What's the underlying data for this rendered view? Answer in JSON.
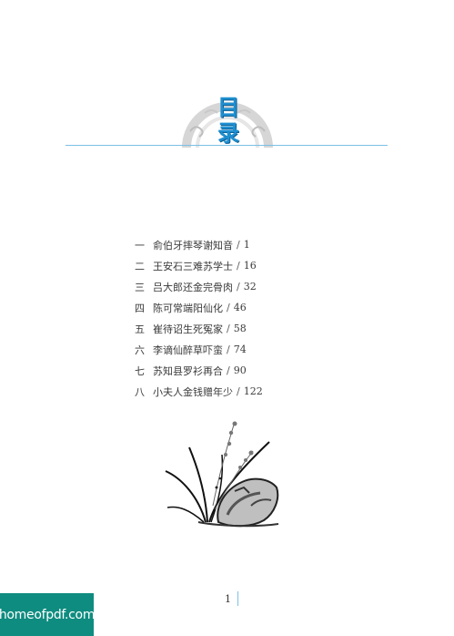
{
  "title": {
    "chars": [
      "目",
      "录"
    ]
  },
  "toc": {
    "items": [
      {
        "num": "一",
        "title": "俞伯牙摔琴谢知音",
        "page": "1"
      },
      {
        "num": "二",
        "title": "王安石三难苏学士",
        "page": "16"
      },
      {
        "num": "三",
        "title": "吕大郎还金完骨肉",
        "page": "32"
      },
      {
        "num": "四",
        "title": "陈可常端阳仙化",
        "page": "46"
      },
      {
        "num": "五",
        "title": "崔待诏生死冤家",
        "page": "58"
      },
      {
        "num": "六",
        "title": "李谪仙醉草吓蛮",
        "page": "74"
      },
      {
        "num": "七",
        "title": "苏知县罗衫再合",
        "page": "90"
      },
      {
        "num": "八",
        "title": "小夫人金钱赠年少",
        "page": "122"
      }
    ],
    "separator": "/"
  },
  "footer": {
    "page_number": "1"
  },
  "watermark": {
    "text": "homeofpdf.com"
  },
  "colors": {
    "accent": "#1f8fd0",
    "rule": "#7cc1e6",
    "badge": "#0f8c80"
  }
}
